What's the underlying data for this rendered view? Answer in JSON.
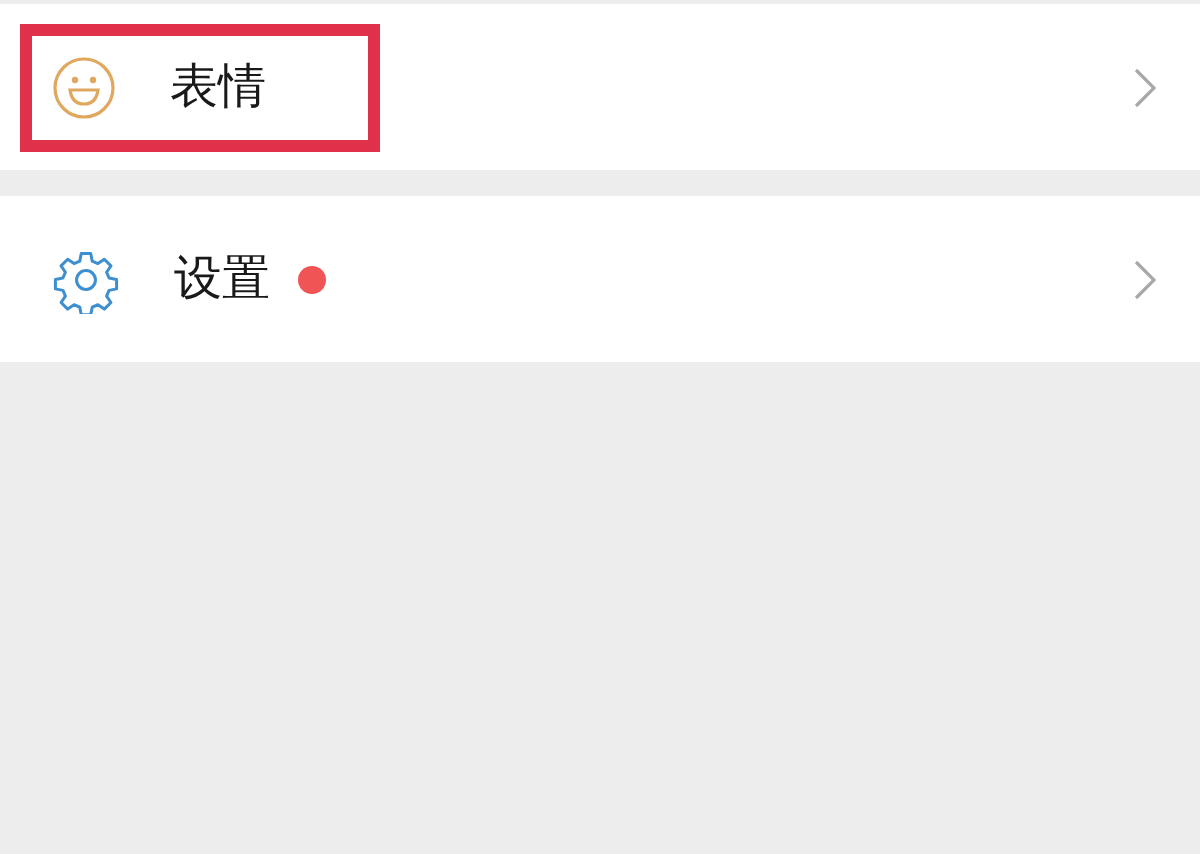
{
  "menu": [
    {
      "kind": "emoji",
      "label": "表情",
      "badge": false,
      "highlighted": true
    },
    {
      "kind": "settings",
      "label": "设置",
      "badge": true,
      "highlighted": false
    }
  ]
}
